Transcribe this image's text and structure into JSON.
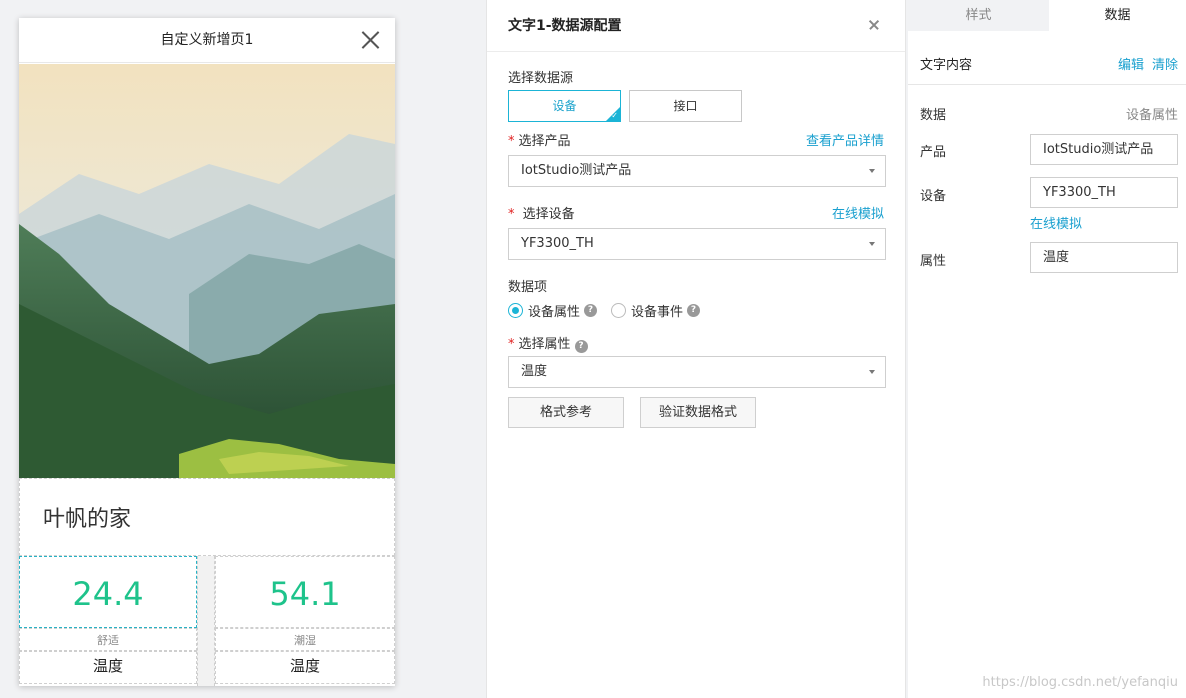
{
  "phone": {
    "title": "自定义新增页1",
    "home_title": "叶帆的家",
    "cards": [
      {
        "value": "24.4",
        "status": "舒适",
        "name": "温度"
      },
      {
        "value": "54.1",
        "status": "潮湿",
        "name": "温度"
      }
    ]
  },
  "config": {
    "title": "文字1-数据源配置",
    "source_label": "选择数据源",
    "source_options": [
      "设备",
      "接口"
    ],
    "product_label": "选择产品",
    "product_link": "查看产品详情",
    "product_value": "IotStudio测试产品",
    "device_label": "选择设备",
    "device_link": "在线模拟",
    "device_value": "YF3300_TH",
    "data_item_label": "数据项",
    "radio_property": "设备属性",
    "radio_event": "设备事件",
    "attr_label": "选择属性",
    "attr_value": "温度",
    "format_button": "格式参考",
    "verify_button": "验证数据格式"
  },
  "props": {
    "tabs": [
      "样式",
      "数据"
    ],
    "text_content_label": "文字内容",
    "edit_link": "编辑",
    "clear_link": "清除",
    "data_label": "数据",
    "data_value": "设备属性",
    "product_label": "产品",
    "product_value": "IotStudio测试产品",
    "device_label": "设备",
    "device_value": "YF3300_TH",
    "simulate_link": "在线模拟",
    "attr_label": "属性",
    "attr_value": "温度"
  },
  "watermark": "https://blog.csdn.net/yefanqiu",
  "colors": {
    "accent": "#1bb4d6",
    "link": "#1aa0cf",
    "value_green": "#1ec38b",
    "required": "#e02020"
  }
}
